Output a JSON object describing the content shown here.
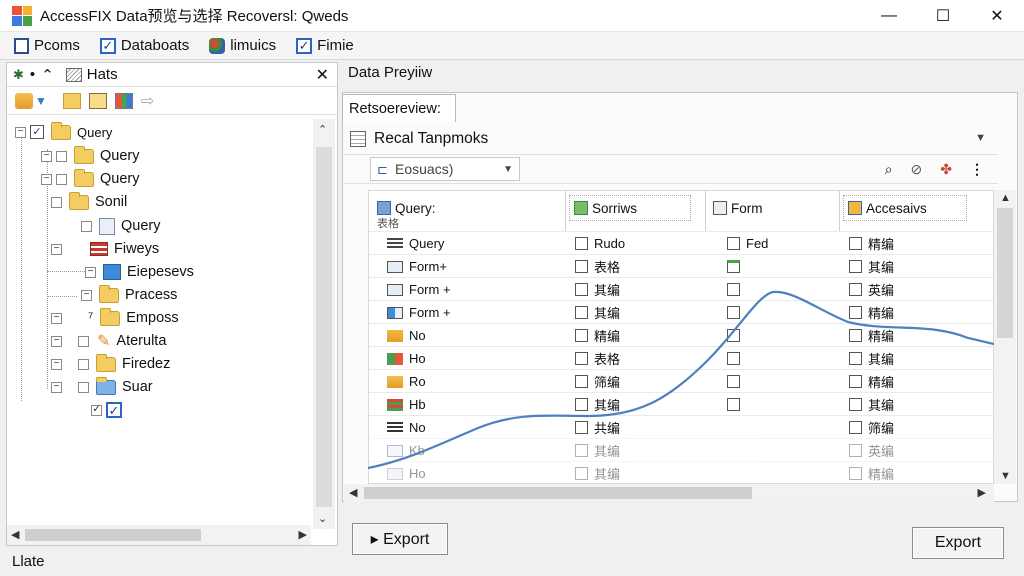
{
  "window": {
    "title": "AccessFIX Data预览与选择 Recoversl: Qweds",
    "minimize": "—",
    "maximize": "☐",
    "close": "✕"
  },
  "menu": [
    {
      "label": "Pcoms"
    },
    {
      "label": "Databoats",
      "checked": true
    },
    {
      "label": "limuics"
    },
    {
      "label": "Fimie",
      "checked": true
    }
  ],
  "left_panel": {
    "header": "Hats",
    "close": "✕",
    "tree": [
      {
        "label": "Query",
        "checked": true
      },
      {
        "label": "Query"
      },
      {
        "label": "Query"
      },
      {
        "label": "Sonil"
      },
      {
        "label": "Query"
      },
      {
        "label": "Fiweys"
      },
      {
        "label": "Eiepesevs"
      },
      {
        "label": "Pracess"
      },
      {
        "label": "Emposs"
      },
      {
        "label": "Aterulta"
      },
      {
        "label": "Firedez"
      },
      {
        "label": "Suar"
      }
    ]
  },
  "status": {
    "text": "Llate"
  },
  "right_panel": {
    "title": "Data Preyiiw",
    "tab": "Retsoereview:",
    "section": "Recal Tanpmoks",
    "combo_value": "Eosuacs)",
    "columns": [
      "Query:",
      "Sorriws",
      "Form",
      "Accesaivs"
    ],
    "subheader": "表格",
    "rows": [
      {
        "name": "Query",
        "c2": "Rudo",
        "c3": "Fed",
        "c4": "精编"
      },
      {
        "name": "Form+",
        "c2": "表格",
        "c3": "",
        "c4": "其编"
      },
      {
        "name": "Form +",
        "c2": "其编",
        "c3": "",
        "c4": "英编"
      },
      {
        "name": "Form +",
        "c2": "其编",
        "c3": "",
        "c4": "精编"
      },
      {
        "name": "No",
        "c2": "精编",
        "c3": "",
        "c4": "精编"
      },
      {
        "name": "Ho",
        "c2": "表格",
        "c3": "",
        "c4": "其编"
      },
      {
        "name": "Ro",
        "c2": "筛编",
        "c3": "",
        "c4": "精编"
      },
      {
        "name": "Hb",
        "c2": "其编",
        "c3": "",
        "c4": "其编"
      },
      {
        "name": "No",
        "c2": "共编",
        "c3": "",
        "c4": "筛编"
      },
      {
        "name": "Kb",
        "c2": "其编",
        "c3": "",
        "c4": "英编"
      },
      {
        "name": "Ho",
        "c2": "其编",
        "c3": "",
        "c4": "精编"
      }
    ],
    "export_left": "▸ Export",
    "export_right": "Export"
  },
  "colors": {
    "accent": "#2a64c9",
    "curve": "#4f7fbf",
    "folder": "#f4cd62"
  },
  "icons": [
    "app-icon",
    "folder-icon",
    "checkbox-icon",
    "search-icon",
    "tag-icon",
    "more-icon"
  ]
}
